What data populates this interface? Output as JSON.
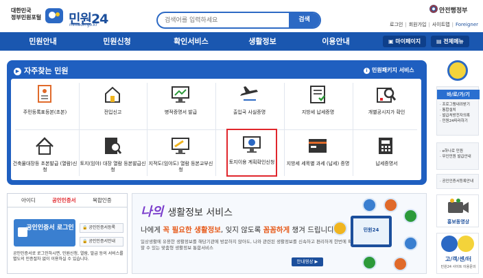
{
  "header": {
    "logo_line1": "대한민국",
    "logo_line2": "정부민원포털",
    "logo_name": "민원24",
    "logo_url": "minwon.go.kr",
    "search_placeholder": "검색어를 입력하세요",
    "search_button": "검색",
    "ministry": "안전행정부",
    "util_links": [
      "로그인",
      "회원가입",
      "사이트맵",
      "Foreigner"
    ]
  },
  "nav": {
    "items": [
      "민원안내",
      "민원신청",
      "확인서비스",
      "생활정보",
      "이용안내"
    ],
    "mypage": "마이페이지",
    "all_menu": "전체메뉴"
  },
  "favorites": {
    "title": "자주찾는 민원",
    "package_link": "민원패키지 서비스",
    "items": [
      {
        "label": "주민등록표등본(초본)",
        "icon": "resident-registration-icon"
      },
      {
        "label": "전입신고",
        "icon": "house-move-icon"
      },
      {
        "label": "병적증명서 발급",
        "icon": "military-record-icon"
      },
      {
        "label": "출입국 사실증명",
        "icon": "airplane-icon"
      },
      {
        "label": "지방세 납세증명",
        "icon": "tax-certificate-icon"
      },
      {
        "label": "개별공시지가 확인",
        "icon": "land-price-icon"
      },
      {
        "label": "건축물대장등 초본발급 (열람)신청",
        "icon": "building-ledger-icon"
      },
      {
        "label": "토지(임야) 대장 열람 등본발급신청",
        "icon": "land-ledger-icon"
      },
      {
        "label": "지적도(임야도) 열람 등본교부신청",
        "icon": "cadastral-map-icon"
      },
      {
        "label": "토지이용 계획확인신청",
        "icon": "land-use-plan-icon",
        "highlighted": true
      },
      {
        "label": "지방세 세목별 과세 (납세) 증명",
        "icon": "tax-item-icon"
      },
      {
        "label": "납세증명서",
        "icon": "tax-payment-icon"
      }
    ]
  },
  "login": {
    "tabs": [
      "아이디",
      "공인인증서",
      "복합인증"
    ],
    "active_tab": "공인인증서",
    "cert_button": "공인인증서 로그인",
    "links": [
      "공인인증서등록",
      "공인인증서안내"
    ],
    "note": "공인인증서로 로그인하시면, 민원신청, 열람, 발급 등의 서비스를 별도의 인증절차 없이 이용하실 수 있습니다."
  },
  "life": {
    "title_prefix": "나의",
    "title": "생활정보 서비스",
    "headline_pre": "나에게 ",
    "headline_hl1": "꼭 필요한 생활정보",
    "headline_mid": ", 잊지 않도록 ",
    "headline_hl2": "꼼꼼하게",
    "headline_post": " 챙겨 드립니다.",
    "desc": "일상생활에 유용한 생활정보를 해당기관에 방문하지 않아도, 나와 관련된 생활정보를 신속하고 편리하게 한번에 확인 할 수 있는 맞춤형 생활정보 통합서비스",
    "guide_button": "안내영상 ▶",
    "monitor_text": "민원24"
  },
  "right": {
    "banner1_head": "바/로/가/기",
    "banner1_items": [
      "· 프로그램내려받기",
      "· 통합설치",
      "· 발급처방전자의록",
      "· 민원24따라하기"
    ],
    "banner2_items": [
      "· e하나로 민원",
      "· 무인민원 발급안내"
    ],
    "banner3_items": [
      "· 공인인증서등록안내"
    ],
    "promo": "홍보동영상",
    "help_head": "고/객/센/터",
    "help_sub": "민원24 사이트 이용문의"
  },
  "colors": {
    "brand_blue": "#1a57b0",
    "panel_blue": "#1f5fc0",
    "highlight_red": "#e0252b",
    "accent_orange": "#e65a1a"
  }
}
